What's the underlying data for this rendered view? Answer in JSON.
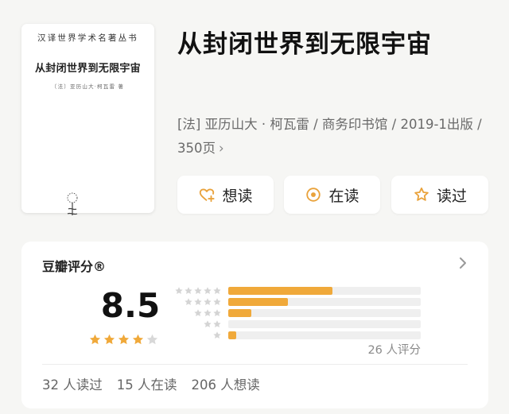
{
  "cover": {
    "series": "汉译世界学术名著丛书",
    "title": "从封闭世界到无限宇宙",
    "author_line": "〔法〕亚历山大·柯瓦雷 著"
  },
  "book": {
    "title": "从封闭世界到无限宇宙",
    "meta": "[法] 亚历山大 · 柯瓦雷 / 商务印书馆 / 2019-1出版 / 350页",
    "meta_chevron": "›"
  },
  "actions": {
    "want_label": "想读",
    "reading_label": "在读",
    "read_label": "读过"
  },
  "rating": {
    "label": "豆瓣评分®",
    "score": "8.5",
    "stars": 4,
    "distribution": [
      {
        "stars": 5,
        "fraction": 0.54
      },
      {
        "stars": 4,
        "fraction": 0.31
      },
      {
        "stars": 3,
        "fraction": 0.12
      },
      {
        "stars": 2,
        "fraction": 0.0
      },
      {
        "stars": 1,
        "fraction": 0.04
      }
    ],
    "count_text": "26 人评分",
    "accent_color": "#f0a93a",
    "track_color": "#efefef"
  },
  "stats": {
    "read": "32 人读过",
    "reading": "15 人在读",
    "want": "206 人想读"
  }
}
